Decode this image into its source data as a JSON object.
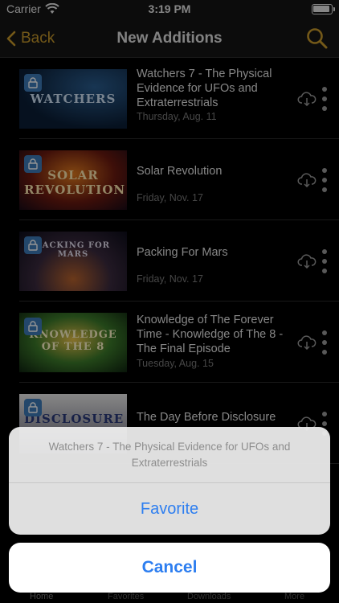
{
  "status": {
    "carrier": "Carrier",
    "time": "3:19 PM"
  },
  "nav": {
    "back_label": "Back",
    "title": "New Additions"
  },
  "items": [
    {
      "title": "Watchers 7 - The Physical Evidence for UFOs and Extraterrestrials",
      "date": "Thursday, Aug. 11",
      "thumb_text": "WATCHERS"
    },
    {
      "title": "Solar Revolution",
      "date": "Friday, Nov. 17",
      "thumb_text": "SOLAR REVOLUTION"
    },
    {
      "title": "Packing For Mars",
      "date": "Friday, Nov. 17",
      "thumb_text": "PACKING FOR MARS"
    },
    {
      "title": "Knowledge of The Forever Time - Knowledge of The 8 - The Final Episode",
      "date": "Tuesday, Aug. 15",
      "thumb_text": "KNOWLEDGE OF THE 8"
    },
    {
      "title": "The Day Before Disclosure",
      "date": "",
      "thumb_text": "DISCLOSURE"
    }
  ],
  "tabs": [
    "Home",
    "Favorites",
    "Downloads",
    "More"
  ],
  "action_sheet": {
    "message": "Watchers 7 - The Physical Evidence for UFOs and Extraterrestrials",
    "favorite_label": "Favorite",
    "cancel_label": "Cancel"
  },
  "colors": {
    "accent": "#c89a2b",
    "link_blue": "#2d7ef0",
    "lock_blue": "#3d7ab8"
  }
}
